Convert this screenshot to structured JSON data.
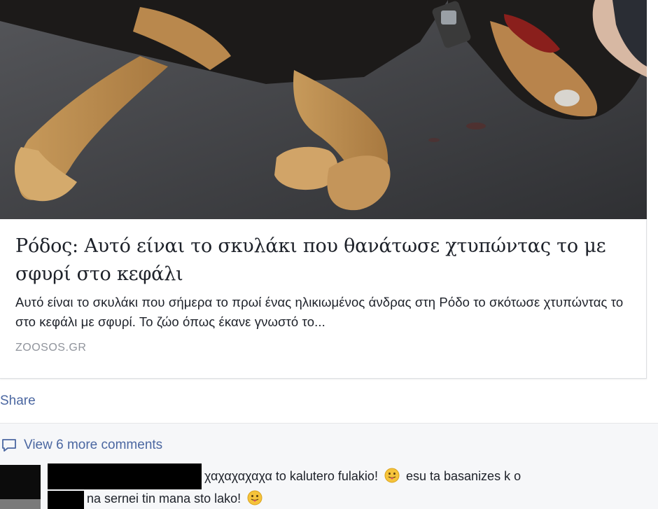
{
  "link_preview": {
    "headline": "Ρόδος: Αυτό είναι το σκυλάκι που θανάτωσε χτυπώντας το με σφυρί στο κεφάλι",
    "description": "Αυτό είναι το σκυλάκι που σήμερα το πρωί ένας ηλικιωμένος άνδρας στη Ρόδο το σκότωσε χτυπώντας το στο κεφάλι με σφυρί. Το ζώο όπως έκανε γνωστό το...",
    "domain": "ZOOSOS.GR"
  },
  "actions": {
    "share_label": "Share"
  },
  "comments": {
    "view_more_label": "View 6 more comments",
    "first_comment": {
      "text_part1": "χαχαχαχαχα to kalutero fulakio!",
      "text_part2": "esu ta basanizes k o",
      "text_part3": "na sernei tin mana sto lako!"
    }
  },
  "colors": {
    "link_blue": "#4b67a1",
    "text_dark": "#1d2129",
    "domain_gray": "#90949c"
  }
}
